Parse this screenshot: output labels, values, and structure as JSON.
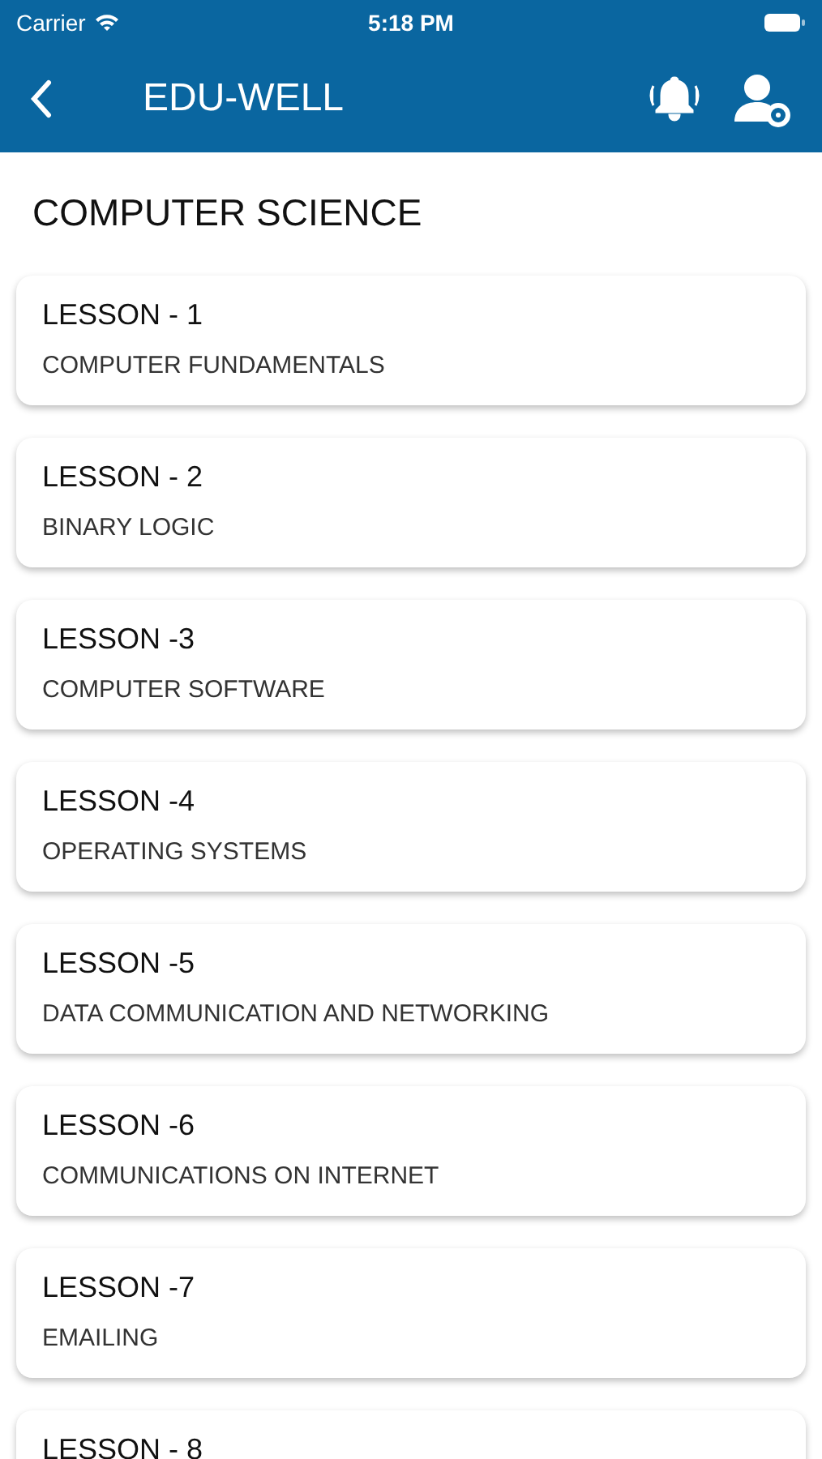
{
  "status_bar": {
    "carrier": "Carrier",
    "time": "5:18 PM"
  },
  "nav_bar": {
    "title": "EDU-WELL"
  },
  "heading": "COMPUTER SCIENCE",
  "lessons": [
    {
      "title": "LESSON - 1",
      "subtitle": "COMPUTER FUNDAMENTALS"
    },
    {
      "title": "LESSON - 2",
      "subtitle": "BINARY LOGIC"
    },
    {
      "title": "LESSON -3",
      "subtitle": "COMPUTER SOFTWARE"
    },
    {
      "title": "LESSON -4",
      "subtitle": "OPERATING SYSTEMS"
    },
    {
      "title": "LESSON -5",
      "subtitle": "DATA COMMUNICATION AND NETWORKING"
    },
    {
      "title": "LESSON -6",
      "subtitle": "COMMUNICATIONS ON INTERNET"
    },
    {
      "title": "LESSON -7",
      "subtitle": "EMAILING"
    },
    {
      "title": "LESSON - 8"
    }
  ]
}
